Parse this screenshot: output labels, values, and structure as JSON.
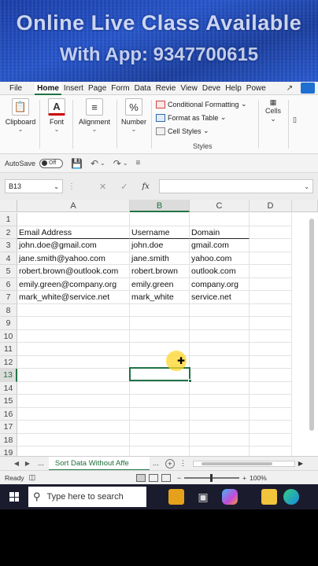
{
  "banner": {
    "line1": "Online Live Class Available",
    "line2": "With App: 9347700615"
  },
  "ribbon_tabs": [
    "File",
    "Home",
    "Insert",
    "Page",
    "Form",
    "Data",
    "Revie",
    "View",
    "Deve",
    "Help",
    "Powe"
  ],
  "active_tab": "Home",
  "ribbon": {
    "clipboard": "Clipboard",
    "font": "Font",
    "alignment": "Alignment",
    "number": "Number",
    "number_symbol": "%",
    "conditional_formatting": "Conditional Formatting",
    "format_as_table": "Format as Table",
    "cell_styles": "Cell Styles",
    "styles_group": "Styles",
    "cells": "Cells"
  },
  "quick_access": {
    "autosave_label": "AutoSave",
    "autosave_state": "Off"
  },
  "formula_bar": {
    "name_box": "B13",
    "fx": "fx",
    "value": ""
  },
  "columns": [
    "A",
    "B",
    "C",
    "D"
  ],
  "selected_column": "B",
  "rows": [
    "1",
    "2",
    "3",
    "4",
    "5",
    "6",
    "7",
    "8",
    "9",
    "10",
    "11",
    "12",
    "13",
    "14",
    "15",
    "16",
    "17",
    "18",
    "19"
  ],
  "selected_row": "13",
  "table": {
    "headers": [
      "Email Address",
      "Username",
      "Domain"
    ],
    "data": [
      [
        "john.doe@gmail.com",
        "john.doe",
        "gmail.com"
      ],
      [
        "jane.smith@yahoo.com",
        "jane.smith",
        "yahoo.com"
      ],
      [
        "robert.brown@outlook.com",
        "robert.brown",
        "outlook.com"
      ],
      [
        "emily.green@company.org",
        "emily.green",
        "company.org"
      ],
      [
        "mark_white@service.net",
        "mark_white",
        "service.net"
      ]
    ]
  },
  "sheet_tabs": {
    "ellipsis": "...",
    "active_sheet": "Sort Data Without Affe",
    "more": "..."
  },
  "status_bar": {
    "mode": "Ready",
    "zoom": "100%"
  },
  "taskbar": {
    "search_placeholder": "Type here to search"
  },
  "colors": {
    "excel_green": "#217346",
    "banner_blue": "#2755c9",
    "taskbar": "#1b1b2e"
  }
}
